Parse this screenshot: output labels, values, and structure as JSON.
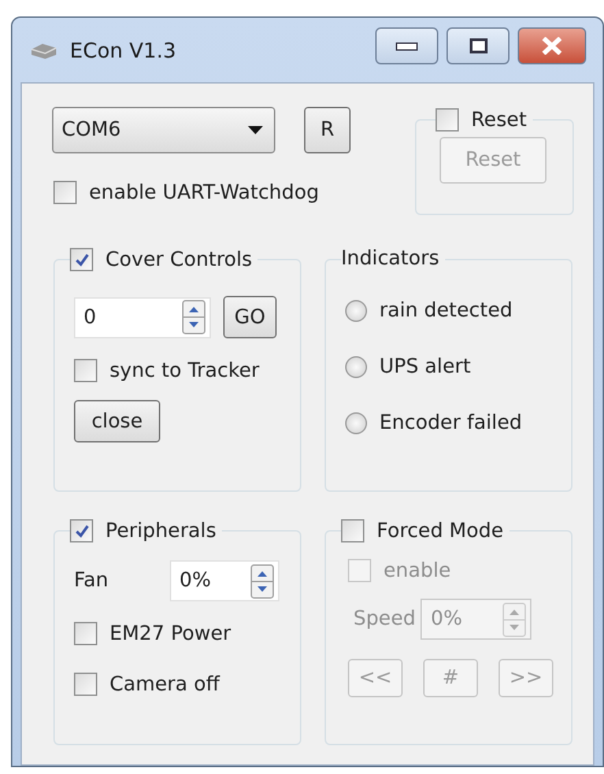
{
  "window": {
    "title": "ECon V1.3"
  },
  "port": {
    "value": "COM6"
  },
  "refresh_button": {
    "label": "R"
  },
  "watchdog": {
    "label": "enable UART-Watchdog",
    "checked": false
  },
  "reset_group": {
    "label": "Reset",
    "checked": false,
    "button": {
      "label": "Reset",
      "disabled": true
    }
  },
  "cover_controls": {
    "label": "Cover Controls",
    "checked": true,
    "position": {
      "value": "0"
    },
    "go_button": {
      "label": "GO"
    },
    "sync": {
      "label": "sync to Tracker",
      "checked": false
    },
    "close_button": {
      "label": "close"
    }
  },
  "indicators": {
    "label": "Indicators",
    "items": [
      {
        "label": "rain detected",
        "on": false
      },
      {
        "label": "UPS alert",
        "on": false
      },
      {
        "label": "Encoder failed",
        "on": false
      }
    ]
  },
  "peripherals": {
    "label": "Peripherals",
    "checked": true,
    "fan": {
      "label": "Fan",
      "value": "0%"
    },
    "items": [
      {
        "label": "EM27 Power",
        "checked": false
      },
      {
        "label": "Camera off",
        "checked": false
      }
    ]
  },
  "forced_mode": {
    "label": "Forced Mode",
    "checked": false,
    "enable": {
      "label": "enable",
      "checked": false,
      "disabled": true
    },
    "speed": {
      "label": "Speed",
      "value": "0%",
      "disabled": true
    },
    "buttons": [
      {
        "label": "<<",
        "disabled": true
      },
      {
        "label": "#",
        "disabled": true
      },
      {
        "label": ">>",
        "disabled": true
      }
    ]
  }
}
